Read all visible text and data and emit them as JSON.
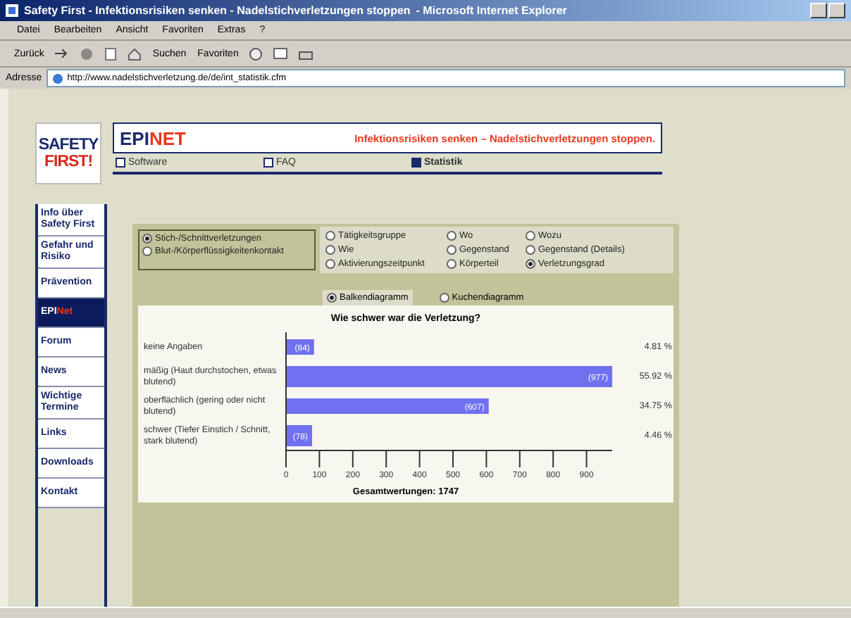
{
  "window": {
    "title": "Safety First - Infektionsrisiken senken - Nadelstichverletzungen stoppen",
    "app_name": "- Microsoft Internet Explorer"
  },
  "menu": [
    "Datei",
    "Bearbeiten",
    "Ansicht",
    "Favoriten",
    "Extras",
    "?"
  ],
  "toolbar": {
    "back": "Zurück",
    "search": "Suchen",
    "favorites": "Favoriten"
  },
  "address": {
    "label": "Adresse",
    "value": "http://www.nadelstichverletzung.de/de/int_statistik.cfm"
  },
  "logo": {
    "line_1": "SAFETY",
    "line_2": "FIRST!"
  },
  "brand": {
    "primary": "EPI",
    "accent": "NET",
    "slogan": "Infektionsrisiken senken – Nadelstichverletzungen stoppen."
  },
  "nav": [
    {
      "label": "Software",
      "selected": false
    },
    {
      "label": "FAQ",
      "selected": false
    },
    {
      "label": "Statistik",
      "selected": true
    }
  ],
  "sidebar": {
    "items": [
      {
        "label": "Info über Safety First",
        "selected": false
      },
      {
        "label": "Gefahr und Risiko",
        "selected": false
      },
      {
        "label": "Prävention",
        "selected": false
      },
      {
        "label": "EPI",
        "label_accent": "Net",
        "selected": true
      },
      {
        "label": "Forum",
        "selected": false
      },
      {
        "label": "News",
        "selected": false
      },
      {
        "label": "Wichtige Termine",
        "selected": false
      },
      {
        "label": "Links",
        "selected": false
      },
      {
        "label": "Downloads",
        "selected": false
      },
      {
        "label": "Kontakt",
        "selected": false
      }
    ]
  },
  "injury_types": [
    {
      "label": "Stich-/Schnittverletzungen",
      "selected": true
    },
    {
      "label": "Blut-/Körperflüssigkeitenkontakt",
      "selected": false
    }
  ],
  "categories": [
    {
      "label": "Tätigkeitsgruppe",
      "selected": false
    },
    {
      "label": "Wo",
      "selected": false
    },
    {
      "label": "Wozu",
      "selected": false
    },
    {
      "label": "Wie",
      "selected": false
    },
    {
      "label": "Gegenstand",
      "selected": false
    },
    {
      "label": "Gegenstand (Details)",
      "selected": false
    },
    {
      "label": "Aktivierungszeitpunkt",
      "selected": false
    },
    {
      "label": "Körperteil",
      "selected": false
    },
    {
      "label": "Verletzungsgrad",
      "selected": true
    }
  ],
  "chart_types": [
    {
      "label": "Balkendiagramm",
      "selected": true
    },
    {
      "label": "Kuchendiagramm",
      "selected": false
    }
  ],
  "chart": {
    "percentages": [
      "4.81 %",
      "55.92 %",
      "34.75 %",
      "4.46 %"
    ],
    "total": "Gesamtwertungen: 1747",
    "chart_data": {
      "type": "bar",
      "orientation": "horizontal",
      "title": "Wie schwer war die Verletzung?",
      "categories": [
        "keine Angaben",
        "mäßig (Haut durchstochen, etwas blutend)",
        "oberflächlich (gering oder nicht blutend)",
        "schwer (Tiefer Einstich / Schnitt, stark blutend)"
      ],
      "values": [
        84,
        977,
        607,
        78
      ],
      "xlim": [
        0,
        977
      ],
      "xticks": [
        {
          "value": 0,
          "label": "0"
        },
        {
          "value": 100,
          "label": "100"
        },
        {
          "value": 200,
          "label": "200"
        },
        {
          "value": 300,
          "label": "300"
        },
        {
          "value": 400,
          "label": "400"
        },
        {
          "value": 500,
          "label": "500"
        },
        {
          "value": 600,
          "label": "600"
        },
        {
          "value": 700,
          "label": "700"
        },
        {
          "value": 800,
          "label": "800"
        },
        {
          "value": 900,
          "label": "900"
        }
      ],
      "value_labels": [
        "(84)",
        "(977)",
        "(607)",
        "(78)"
      ]
    }
  }
}
